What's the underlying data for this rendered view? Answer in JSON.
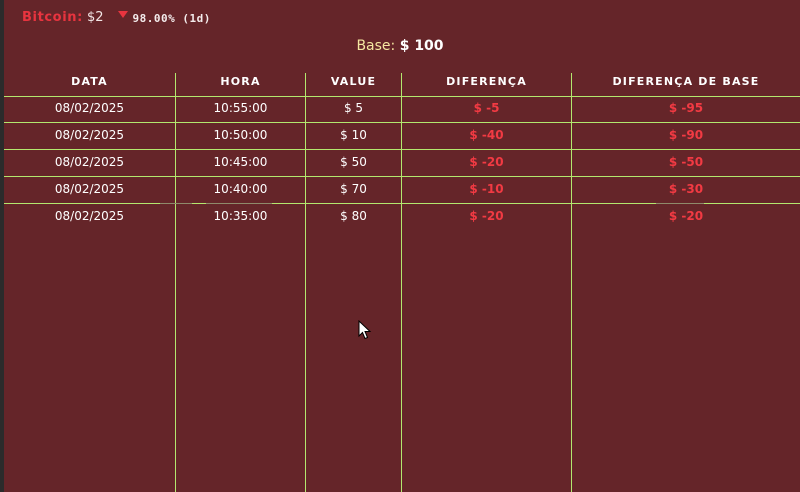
{
  "ticker": {
    "name": "Bitcoin:",
    "price": "$2",
    "change": "98.00% (1d)",
    "change_direction": "down",
    "down_color": "#e8343f"
  },
  "base": {
    "label": "Base:",
    "value": "$ 100"
  },
  "table": {
    "headers": [
      "DATA",
      "HORA",
      "VALUE",
      "DIFERENÇA",
      "DIFERENÇA DE BASE"
    ],
    "rows": [
      [
        "08/02/2025",
        "10:55:00",
        "$ 5",
        "$ -5",
        "$ -95"
      ],
      [
        "08/02/2025",
        "10:50:00",
        "$ 10",
        "$ -40",
        "$ -90"
      ],
      [
        "08/02/2025",
        "10:45:00",
        "$ 50",
        "$ -20",
        "$ -50"
      ],
      [
        "08/02/2025",
        "10:40:00",
        "$ 70",
        "$ -10",
        "$ -30"
      ],
      [
        "08/02/2025",
        "10:35:00",
        "$ 80",
        "$ -20",
        "$ -20"
      ]
    ]
  },
  "colors": {
    "background": "#652529",
    "grid": "#b3e86e",
    "negative": "#f23a43",
    "base_label": "#f5e7a1"
  }
}
